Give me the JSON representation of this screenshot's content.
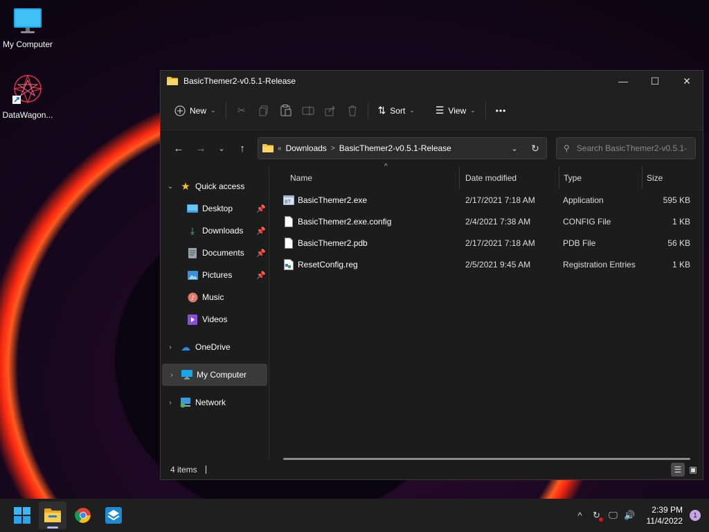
{
  "desktop": {
    "icons": [
      {
        "label": "My Computer",
        "icon": "monitor-icon"
      },
      {
        "label": "DataWagon...",
        "icon": "datawagon-app-icon"
      }
    ]
  },
  "window": {
    "title": "BasicThemer2-v0.5.1-Release",
    "controls": {
      "minimize": "—",
      "maximize": "☐",
      "close": "✕"
    }
  },
  "toolbar": {
    "new_label": "New",
    "sort_label": "Sort",
    "view_label": "View",
    "more_label": "•••",
    "disabled_actions": [
      "cut-icon",
      "copy-icon",
      "paste-icon",
      "rename-icon",
      "share-icon",
      "delete-icon"
    ]
  },
  "address": {
    "overflow": "«",
    "crumbs": [
      "Downloads",
      "BasicThemer2-v0.5.1-Release"
    ]
  },
  "search": {
    "placeholder": "Search BasicThemer2-v0.5.1-..."
  },
  "nav": {
    "quick_access": "Quick access",
    "pinned": [
      {
        "label": "Desktop",
        "pinned": true
      },
      {
        "label": "Downloads",
        "pinned": true
      },
      {
        "label": "Documents",
        "pinned": true
      },
      {
        "label": "Pictures",
        "pinned": true
      },
      {
        "label": "Music",
        "pinned": false
      },
      {
        "label": "Videos",
        "pinned": false
      }
    ],
    "onedrive": "OneDrive",
    "my_computer": "My Computer",
    "network": "Network"
  },
  "columns": {
    "name": "Name",
    "date": "Date modified",
    "type": "Type",
    "size": "Size"
  },
  "files": [
    {
      "name": "BasicThemer2.exe",
      "date": "2/17/2021 7:18 AM",
      "type": "Application",
      "size": "595 KB"
    },
    {
      "name": "BasicThemer2.exe.config",
      "date": "2/4/2021 7:38 AM",
      "type": "CONFIG File",
      "size": "1 KB"
    },
    {
      "name": "BasicThemer2.pdb",
      "date": "2/17/2021 7:18 AM",
      "type": "PDB File",
      "size": "56 KB"
    },
    {
      "name": "ResetConfig.reg",
      "date": "2/5/2021 9:45 AM",
      "type": "Registration Entries",
      "size": "1 KB"
    }
  ],
  "status": {
    "items": "4 items"
  },
  "taskbar": {
    "time": "2:39 PM",
    "date": "11/4/2022",
    "notifications": "1"
  },
  "colors": {
    "accent": "#60cdff",
    "folder": "#f3c13a"
  }
}
